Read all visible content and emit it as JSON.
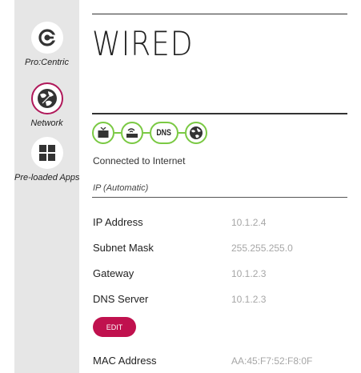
{
  "sidebar": {
    "items": [
      {
        "label": "Pro:Centric",
        "icon": "procentric-icon"
      },
      {
        "label": "Network",
        "icon": "globe-icon",
        "active": true
      },
      {
        "label": "Pre-loaded Apps",
        "icon": "apps-grid-icon"
      }
    ]
  },
  "main": {
    "title": "WIRED",
    "connection_chain": [
      "tv-icon",
      "router-icon",
      "DNS",
      "globe-icon"
    ],
    "connection_dns_label": "DNS",
    "status": "Connected to Internet",
    "ip_mode": "IP (Automatic)",
    "fields": {
      "ip_address": {
        "label": "IP Address",
        "value": "10.1.2.4"
      },
      "subnet_mask": {
        "label": "Subnet Mask",
        "value": "255.255.255.0"
      },
      "gateway": {
        "label": "Gateway",
        "value": "10.1.2.3"
      },
      "dns_server": {
        "label": "DNS Server",
        "value": "10.1.2.3"
      },
      "mac_address": {
        "label": "MAC Address",
        "value": "AA:45:F7:52:F8:0F"
      }
    },
    "edit_label": "EDIT"
  },
  "colors": {
    "sidebar_bg": "#e6e6e6",
    "accent": "#c0114e",
    "connected_green": "#7ac943",
    "value_gray": "#a6a6a6"
  }
}
